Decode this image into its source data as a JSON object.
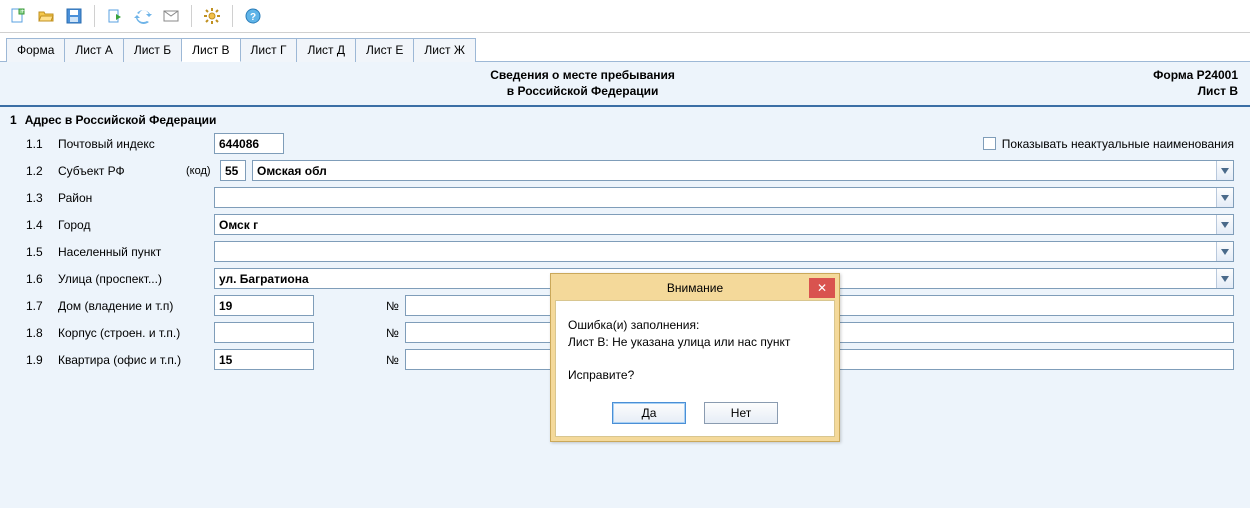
{
  "toolbar_icons": [
    "new-icon",
    "open-icon",
    "save-icon",
    "export-icon",
    "sync-icon",
    "mail-icon",
    "settings-icon",
    "help-icon"
  ],
  "tabs": [
    "Форма",
    "Лист А",
    "Лист Б",
    "Лист В",
    "Лист Г",
    "Лист Д",
    "Лист Е",
    "Лист Ж"
  ],
  "active_tab": "Лист В",
  "header": {
    "title_line1": "Сведения о месте пребывания",
    "title_line2": "в Российской Федерации",
    "form_code": "Форма Р24001",
    "sheet": "Лист В"
  },
  "section": {
    "num": "1",
    "title": "Адрес в Российской Федерации"
  },
  "checkbox_label": "Показывать неактуальные наименования",
  "checkbox_checked": false,
  "fields": {
    "postal": {
      "num": "1.1",
      "label": "Почтовый индекс",
      "value": "644086"
    },
    "region": {
      "num": "1.2",
      "label": "Субъект РФ",
      "codelabel": "(код)",
      "code": "55",
      "value": "Омская обл"
    },
    "district": {
      "num": "1.3",
      "label": "Район",
      "value": ""
    },
    "city": {
      "num": "1.4",
      "label": "Город",
      "value": "Омск г"
    },
    "settlement": {
      "num": "1.5",
      "label": "Населенный пункт",
      "value": ""
    },
    "street": {
      "num": "1.6",
      "label": "Улица (проспект...)",
      "value": "ул. Багратиона"
    },
    "house": {
      "num": "1.7",
      "label": "Дом (владение и т.п)",
      "value": "19",
      "num_label": "№",
      "num_value": ""
    },
    "building": {
      "num": "1.8",
      "label": "Корпус (строен. и т.п.)",
      "value": "",
      "num_label": "№",
      "num_value": ""
    },
    "flat": {
      "num": "1.9",
      "label": "Квартира (офис и т.п.)",
      "value": "15",
      "num_label": "№",
      "num_value": ""
    }
  },
  "dialog": {
    "title": "Внимание",
    "msg_line1": "Ошибка(и) заполнения:",
    "msg_line2": "Лист В: Не указана улица или нас пункт",
    "msg_line3": "Исправите?",
    "btn_yes": "Да",
    "btn_no": "Нет"
  }
}
